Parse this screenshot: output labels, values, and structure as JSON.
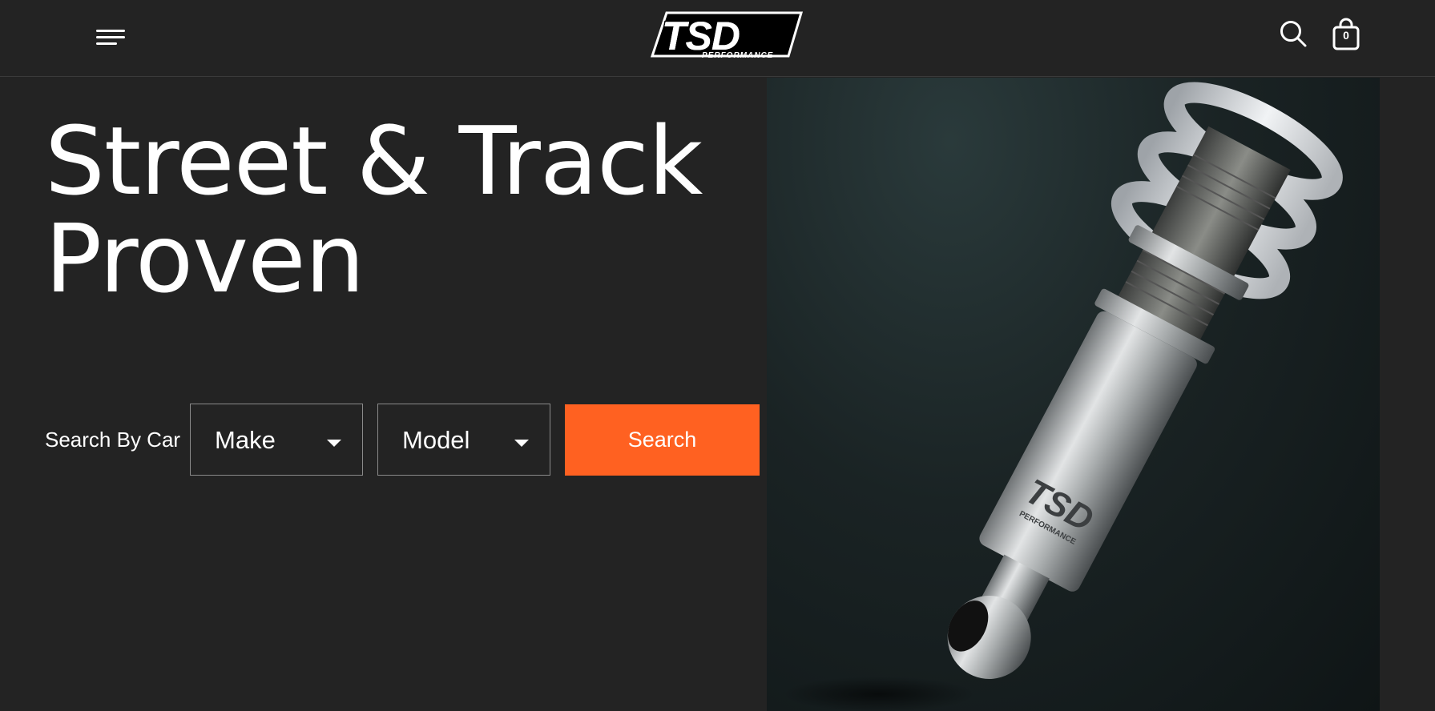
{
  "header": {
    "logo_text": "TSD",
    "logo_subtext": "PERFORMANCE",
    "menu_icon": "hamburger-icon",
    "search_icon": "search-icon",
    "cart_icon": "shopping-bag-icon",
    "cart_count": "0"
  },
  "hero": {
    "title_line1": "Street & Track",
    "title_line2": "Proven",
    "image_description_icon": "coilover-shock-image",
    "product_logo_text": "TSD",
    "product_logo_subtext": "PERFORMANCE"
  },
  "search": {
    "label": "Search By Car",
    "make_value": "Make",
    "model_value": "Model",
    "button_label": "Search"
  },
  "colors": {
    "background": "#232323",
    "accent": "#ff6121",
    "text": "#ffffff"
  }
}
